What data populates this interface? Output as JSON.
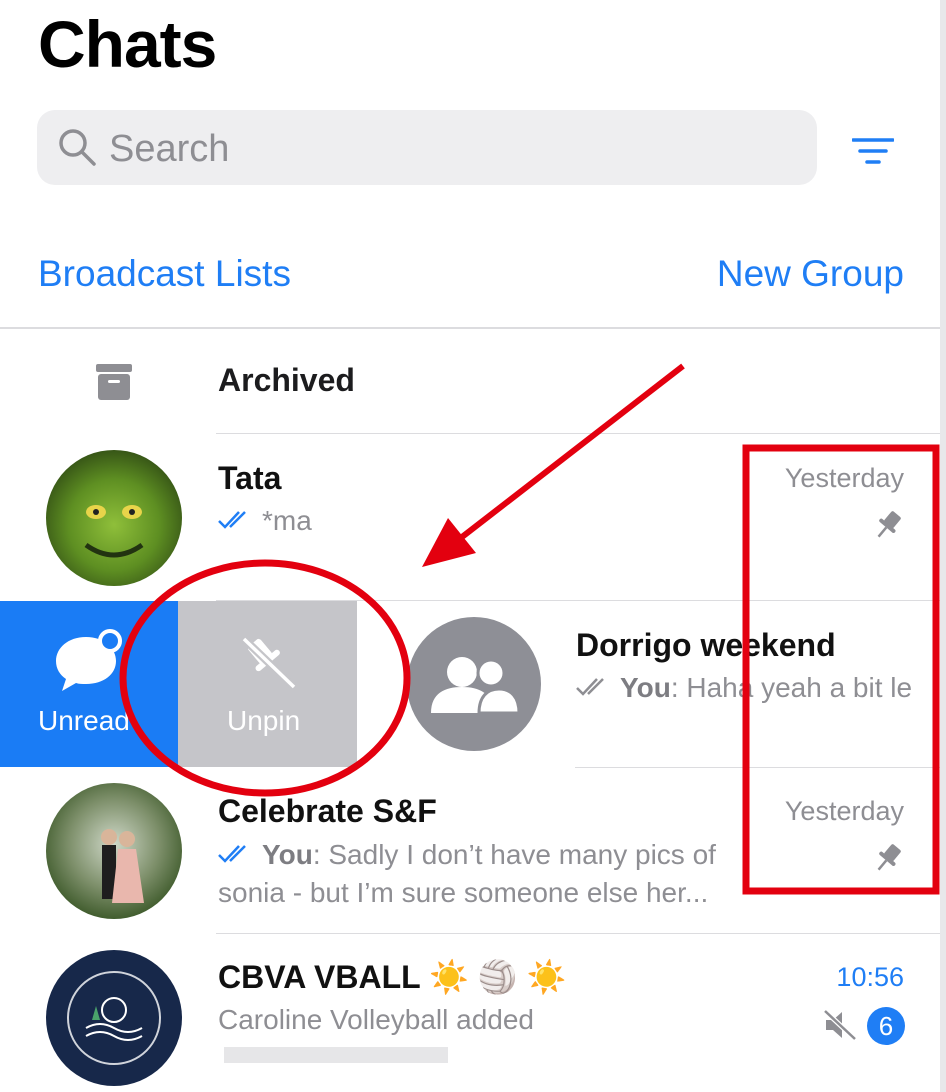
{
  "header": {
    "title": "Chats"
  },
  "search": {
    "placeholder": "Search"
  },
  "links": {
    "broadcast": "Broadcast Lists",
    "new_group": "New Group"
  },
  "archived": {
    "label": "Archived"
  },
  "swipe_actions": {
    "unread": "Unread",
    "unpin": "Unpin"
  },
  "chats": [
    {
      "name": "Tata",
      "preview": "*ma",
      "time": "Yesterday",
      "pinned": true,
      "ticks": "read"
    },
    {
      "name": "Dorrigo weekend",
      "sender": "You",
      "preview": ": Haha yeah a bit le",
      "ticks": "delivered"
    },
    {
      "name": "Celebrate S&F",
      "sender": "You",
      "preview": ": Sadly I don’t have many pics of",
      "preview2": "sonia - but I’m sure someone else her...",
      "time": "Yesterday",
      "pinned": true,
      "ticks": "read"
    },
    {
      "name": "CBVA VBALL ☀️ 🏐 ☀️",
      "preview": "Caroline Volleyball added",
      "time": "10:56",
      "muted": true,
      "unread_count": "6"
    }
  ],
  "colors": {
    "accent": "#1f7ef5",
    "annotation": "#e3000f",
    "unpin_bg": "#c5c5c9"
  }
}
